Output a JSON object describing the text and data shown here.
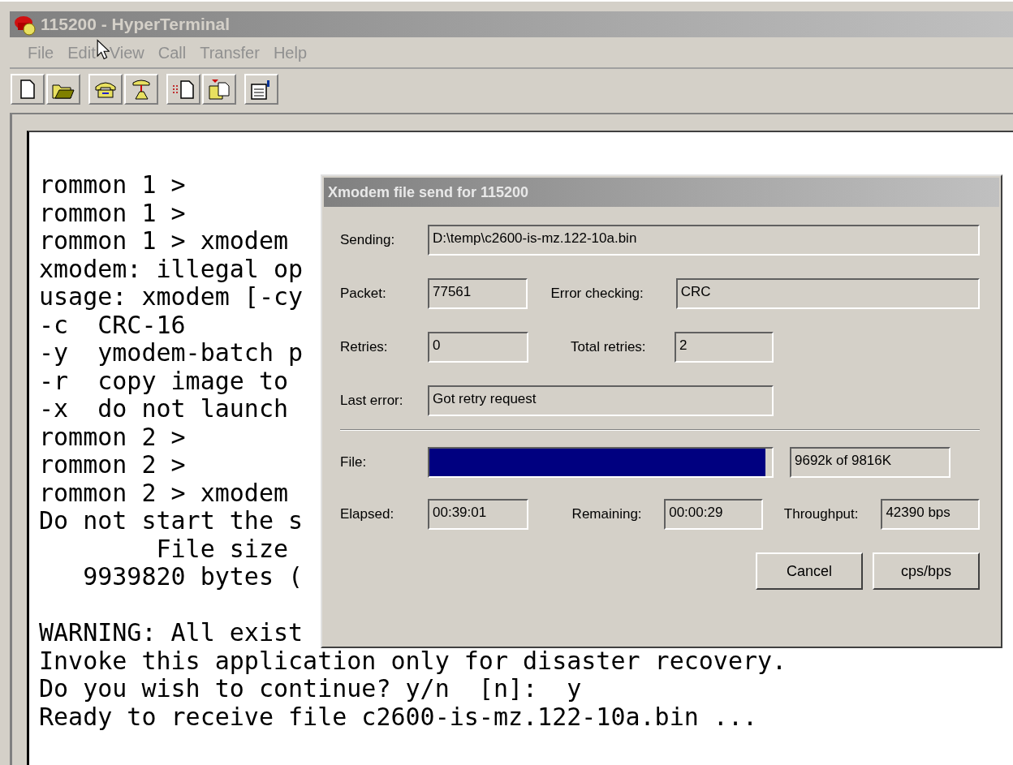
{
  "window": {
    "title": "115200 - HyperTerminal"
  },
  "menu": [
    {
      "label": "File",
      "disabled": true
    },
    {
      "label": "Edit",
      "disabled": true
    },
    {
      "label": "View",
      "disabled": true
    },
    {
      "label": "Call",
      "disabled": true
    },
    {
      "label": "Transfer",
      "disabled": true
    },
    {
      "label": "Help",
      "disabled": true
    }
  ],
  "terminal": {
    "lines": [
      {
        "text": "rommon 1 >"
      },
      {
        "text": "rommon 1 >"
      },
      {
        "text": "rommon 1 > xmodem"
      },
      {
        "text": "xmodem: illegal op"
      },
      {
        "text": "usage: xmodem [-cy"
      },
      {
        "text": "-c  CRC-16"
      },
      {
        "text": "-y  ymodem-batch p"
      },
      {
        "text": "-r  copy image to"
      },
      {
        "text": "-x  do not launch"
      },
      {
        "text": "rommon 2 >"
      },
      {
        "text": "rommon 2 >"
      },
      {
        "text": "rommon 2 > xmodem"
      },
      {
        "text": "Do not start the s"
      },
      {
        "text": "        File size"
      },
      {
        "text": "   9939820 bytes ("
      },
      {
        "text": "WARNING: All exist",
        "gap_before": true
      },
      {
        "text": "Invoke this application only for disaster recovery."
      },
      {
        "text": "Do you wish to continue? y/n  [n]:  y"
      },
      {
        "text": "Ready to receive file c2600-is-mz.122-10a.bin ..."
      }
    ]
  },
  "dialog": {
    "title": "Xmodem file send for 115200",
    "sending": {
      "label": "Sending:",
      "value": "D:\\temp\\c2600-is-mz.122-10a.bin"
    },
    "packet": {
      "label": "Packet:",
      "value": "77561"
    },
    "error_checking": {
      "label": "Error checking:",
      "value": "CRC"
    },
    "retries": {
      "label": "Retries:",
      "value": "0"
    },
    "total_retries": {
      "label": "Total retries:",
      "value": "2"
    },
    "last_error": {
      "label": "Last error:",
      "value": "Got retry request"
    },
    "file": {
      "label": "File:",
      "level": 0.98,
      "reading": "9692k of 9816K"
    },
    "elapsed": {
      "label": "Elapsed:",
      "value": "00:39:01"
    },
    "remaining": {
      "label": "Remaining:",
      "value": "00:00:29"
    },
    "throughput": {
      "label": "Throughput:",
      "value": "42390 bps"
    },
    "buttons": [
      "Cancel",
      "cps/bps"
    ]
  }
}
